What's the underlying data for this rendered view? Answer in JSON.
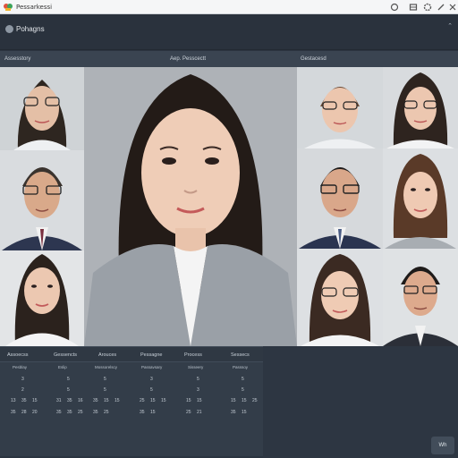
{
  "app": {
    "title": "Pessarkessi"
  },
  "header": {
    "title": "Pohagns"
  },
  "sections": {
    "left": "Assesstory",
    "center": "Aep. Pesscectt",
    "right": "Gestacesd"
  },
  "calendar": {
    "tabs": [
      "Assoecss",
      "Gessencts",
      "Arouces",
      "Pessagne",
      "Process",
      "Sessecs"
    ],
    "columns": [
      {
        "head": "Pesblay",
        "rows": [
          [
            "",
            "3"
          ],
          [
            "",
            "2"
          ],
          [
            "13",
            "35",
            "15"
          ],
          [
            "35",
            "28",
            "20"
          ]
        ]
      },
      {
        "head": "Eslip",
        "rows": [
          [
            "",
            "5"
          ],
          [
            "",
            "5"
          ],
          [
            "31",
            "35",
            "16"
          ],
          [
            "35",
            "35",
            "25"
          ]
        ]
      },
      {
        "head": "Mossorelscy",
        "rows": [
          [
            "",
            "5"
          ],
          [
            "",
            "5"
          ],
          [
            "35",
            "15",
            "15"
          ],
          [
            "35",
            "25"
          ]
        ]
      },
      {
        "head": "Passavsary",
        "rows": [
          [
            "",
            "3"
          ],
          [
            "",
            "5"
          ],
          [
            "25",
            "15",
            "15"
          ],
          [
            "35",
            "15"
          ]
        ]
      },
      {
        "head": "Sisseery",
        "rows": [
          [
            "",
            "5"
          ],
          [
            "",
            "3"
          ],
          [
            "15",
            "15"
          ],
          [
            "25",
            "21"
          ]
        ]
      },
      {
        "head": "Passsoy",
        "rows": [
          [
            "",
            "5"
          ],
          [
            "",
            "5"
          ],
          [
            "15",
            "15",
            "25"
          ],
          [
            "35",
            "15"
          ]
        ]
      }
    ]
  },
  "corner_button": "Wh",
  "icons": {
    "logo": "app-logo-icon",
    "toolbar": [
      "refresh-icon",
      "grid-icon",
      "settings-icon",
      "edit-icon",
      "close-icon"
    ],
    "header_menu": "kebab-menu-icon"
  }
}
